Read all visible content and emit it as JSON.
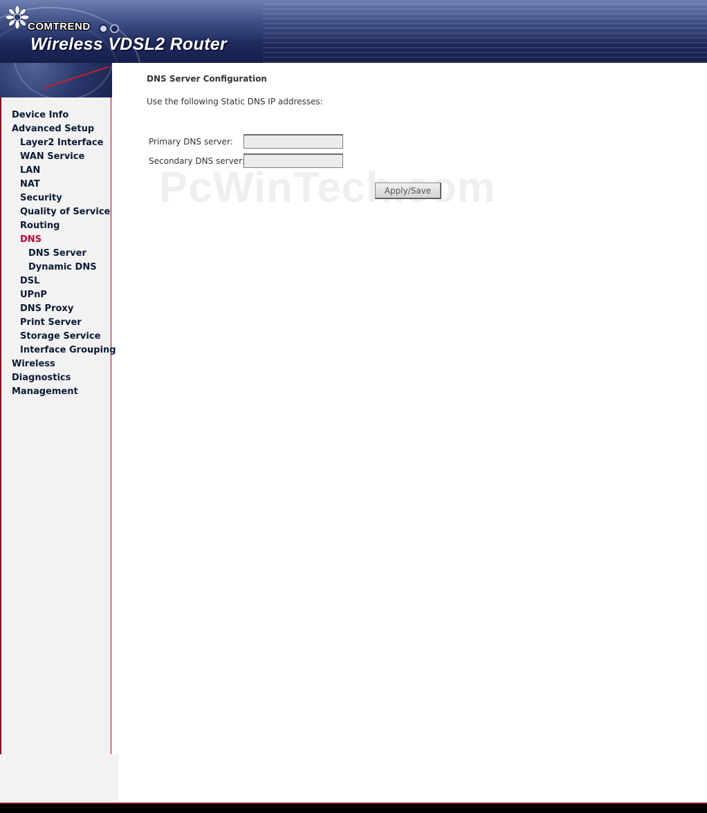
{
  "header": {
    "brand": "COMTREND",
    "product_title": "Wireless VDSL2 Router",
    "colors": {
      "banner_dark": "#1e2a5c",
      "dot1": "#1a2a5a",
      "dot2": "#3a4a7a"
    }
  },
  "sidebar": {
    "items": [
      {
        "label": "Device Info",
        "level": 0
      },
      {
        "label": "Advanced Setup",
        "level": 0
      },
      {
        "label": "Layer2 Interface",
        "level": 1
      },
      {
        "label": "WAN Service",
        "level": 1
      },
      {
        "label": "LAN",
        "level": 1
      },
      {
        "label": "NAT",
        "level": 1
      },
      {
        "label": "Security",
        "level": 1
      },
      {
        "label": "Quality of Service",
        "level": 1
      },
      {
        "label": "Routing",
        "level": 1
      },
      {
        "label": "DNS",
        "level": 1,
        "active": true
      },
      {
        "label": "DNS Server",
        "level": 2
      },
      {
        "label": "Dynamic DNS",
        "level": 2
      },
      {
        "label": "DSL",
        "level": 1
      },
      {
        "label": "UPnP",
        "level": 1
      },
      {
        "label": "DNS Proxy",
        "level": 1
      },
      {
        "label": "Print Server",
        "level": 1
      },
      {
        "label": "Storage Service",
        "level": 1
      },
      {
        "label": "Interface Grouping",
        "level": 1
      },
      {
        "label": "Wireless",
        "level": 0
      },
      {
        "label": "Diagnostics",
        "level": 0
      },
      {
        "label": "Management",
        "level": 0
      }
    ],
    "colors": {
      "link": "#0a1a33",
      "active": "#cc0033",
      "border": "#8a1020"
    }
  },
  "main": {
    "title": "DNS Server Configuration",
    "description": "Use the following Static DNS IP addresses:",
    "primary_label": "Primary DNS server:",
    "primary_value": "",
    "secondary_label": "Secondary DNS server:",
    "secondary_value": "",
    "apply_label": "Apply/Save"
  },
  "watermark": "PcWinTech.com"
}
